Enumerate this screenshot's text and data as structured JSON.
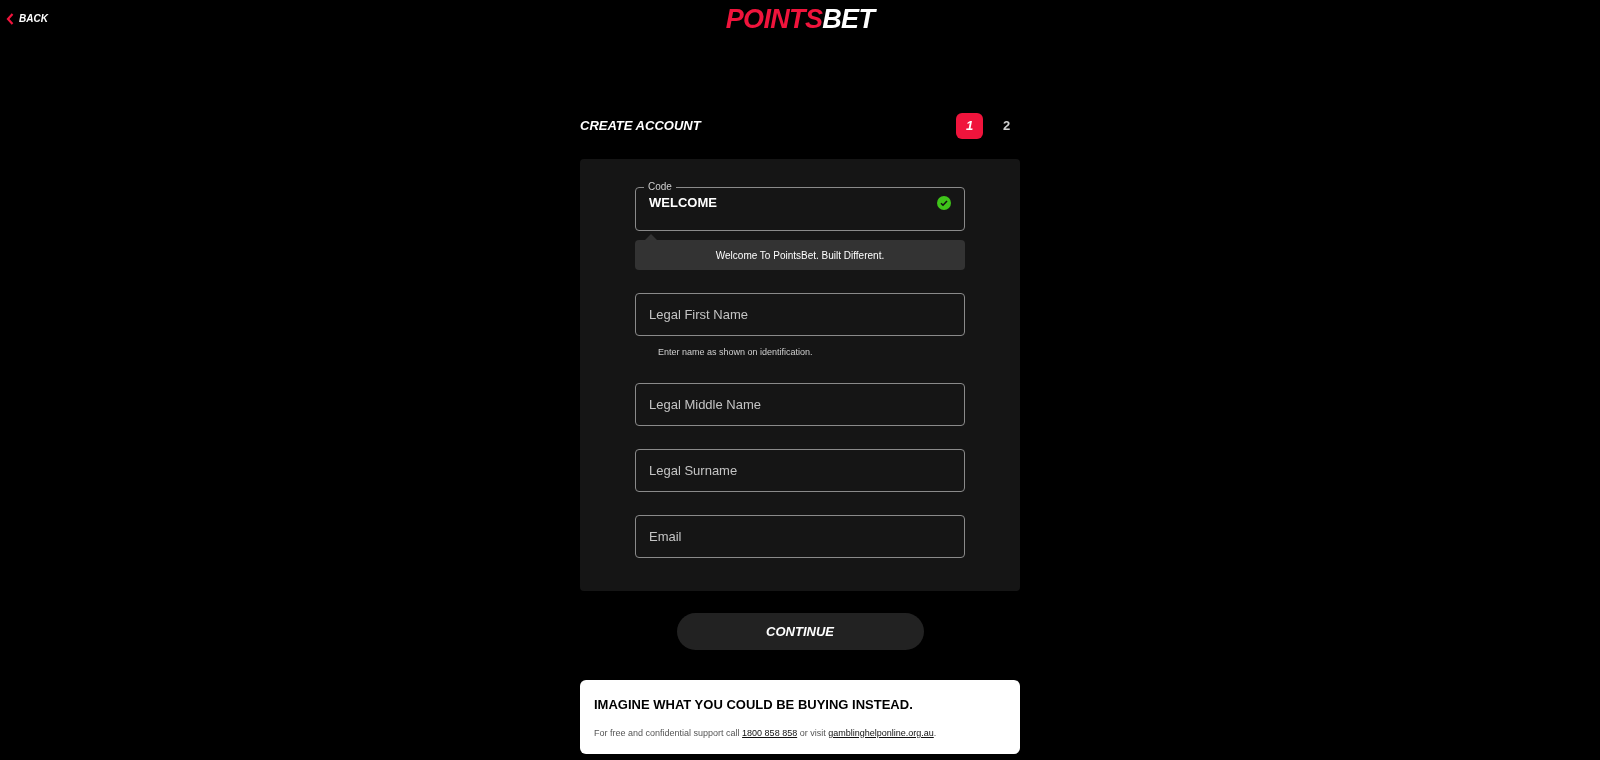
{
  "back": {
    "label": "BACK"
  },
  "logo": {
    "first": "POINTS",
    "second": "BET"
  },
  "title": "CREATE ACCOUNT",
  "steps": [
    {
      "label": "1",
      "selected": true
    },
    {
      "label": "2",
      "selected": false
    }
  ],
  "fields": [
    {
      "kind": "code",
      "label": "Code",
      "value": "WELCOME",
      "valid": true,
      "message": "Welcome To PointsBet. Built Different."
    },
    {
      "kind": "text",
      "placeholder": "Legal First Name",
      "hint": "Enter name as shown on identification."
    },
    {
      "kind": "text",
      "placeholder": "Legal Middle Name"
    },
    {
      "kind": "text",
      "placeholder": "Legal Surname"
    },
    {
      "kind": "text",
      "placeholder": "Email"
    }
  ],
  "continue_button": "CONTINUE",
  "notice": {
    "heading": "IMAGINE WHAT YOU COULD BE BUYING INSTEAD.",
    "support": [
      {
        "kind": "text",
        "text": "For free and confidential support call "
      },
      {
        "kind": "link",
        "text": "1800 858 858"
      },
      {
        "kind": "text",
        "text": " or visit "
      },
      {
        "kind": "link",
        "text": "gamblinghelponline.org.au"
      },
      {
        "kind": "text",
        "text": "."
      }
    ]
  }
}
